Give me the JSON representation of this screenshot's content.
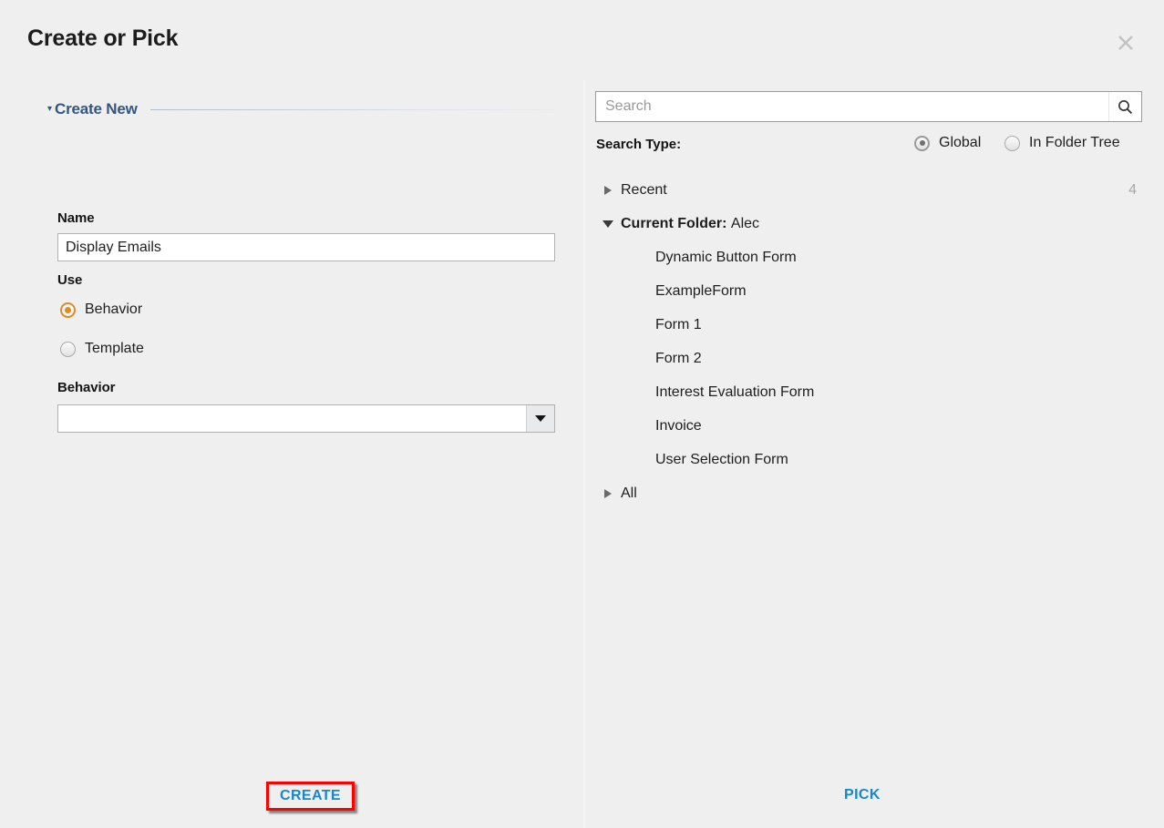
{
  "dialog": {
    "title": "Create or Pick",
    "close_icon": "close-icon"
  },
  "colors": {
    "background": "#efefef",
    "accent_link": "#1787c8",
    "section_heading": "#34557f",
    "radio_selected_orange": "#e08a24",
    "radio_selected_grey": "#6f6f6f",
    "highlight_border": "#ff0000",
    "count_text": "#a8a8a8",
    "placeholder_text": "#9a9a9a"
  },
  "left_panel": {
    "section": {
      "label": "Create New",
      "caret": "▾",
      "expanded": true
    },
    "name_field": {
      "label": "Name",
      "value": "Display Emails",
      "placeholder": ""
    },
    "use_field": {
      "label": "Use",
      "options": [
        {
          "label": "Behavior",
          "selected": true
        },
        {
          "label": "Template",
          "selected": false
        }
      ]
    },
    "behavior_field": {
      "label": "Behavior",
      "value": "",
      "placeholder": "",
      "arrow_icon": "chevron-down-icon"
    }
  },
  "right_panel": {
    "search": {
      "placeholder": "Search",
      "value": "",
      "icon": "search-icon"
    },
    "search_type": {
      "label": "Search Type:",
      "options": [
        {
          "label": "Global",
          "selected": true
        },
        {
          "label": "In Folder Tree",
          "selected": false
        }
      ]
    },
    "tree": {
      "recent": {
        "label": "Recent",
        "count": "4",
        "expanded": false,
        "caret": "▸"
      },
      "current_folder": {
        "label": "Current Folder:",
        "value": "Alec",
        "expanded": true,
        "caret": "▾",
        "items": [
          "Dynamic Button Form",
          "ExampleForm",
          "Form 1",
          "Form 2",
          "Interest Evaluation Form",
          "Invoice",
          "User Selection Form"
        ]
      },
      "all": {
        "label": "All",
        "expanded": false,
        "caret": "▸"
      }
    }
  },
  "footer": {
    "create_label": "CREATE",
    "pick_label": "PICK"
  }
}
